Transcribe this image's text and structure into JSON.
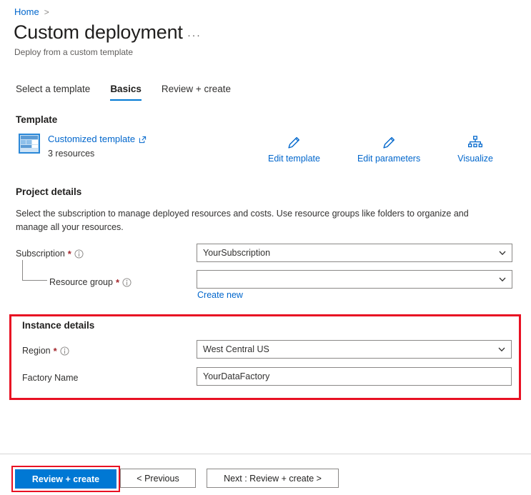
{
  "breadcrumb": {
    "home_label": "Home",
    "separator": ">"
  },
  "header": {
    "title": "Custom deployment",
    "subtitle": "Deploy from a custom template",
    "more_menu": "···"
  },
  "tabs": [
    {
      "label": "Select a template",
      "active": false
    },
    {
      "label": "Basics",
      "active": true
    },
    {
      "label": "Review + create",
      "active": false
    }
  ],
  "template_section": {
    "heading": "Template",
    "icon": "template-grid-icon",
    "link_label": "Customized template",
    "external_icon": "external-link-icon",
    "resource_count": "3 resources",
    "actions": [
      {
        "label": "Edit template",
        "icon": "pencil-icon"
      },
      {
        "label": "Edit parameters",
        "icon": "pencil-icon"
      },
      {
        "label": "Visualize",
        "icon": "hierarchy-icon"
      }
    ]
  },
  "project_details": {
    "heading": "Project details",
    "description": "Select the subscription to manage deployed resources and costs. Use resource groups like folders to organize and manage all your resources.",
    "fields": [
      {
        "label": "Subscription",
        "required": "*",
        "info_icon": "info-icon",
        "value": "YourSubscription",
        "placeholder": "",
        "control": "dropdown"
      },
      {
        "label": "Resource group",
        "required": "*",
        "info_icon": "info-icon",
        "value": "",
        "placeholder": "",
        "control": "dropdown"
      }
    ],
    "create_new_label": "Create new"
  },
  "instance_details": {
    "heading": "Instance details",
    "highlight_color": "#e81123",
    "fields": [
      {
        "label": "Region",
        "required": "*",
        "info_icon": "info-icon",
        "value": "West Central US",
        "control": "dropdown"
      },
      {
        "label": "Factory Name",
        "required": "",
        "info_icon": "",
        "value": "YourDataFactory",
        "control": "text"
      }
    ]
  },
  "footer": {
    "primary_button": "Review + create",
    "previous_button": "< Previous",
    "next_button": "Next : Review + create >",
    "primary_color": "#0078d4",
    "highlight_color": "#e81123"
  }
}
